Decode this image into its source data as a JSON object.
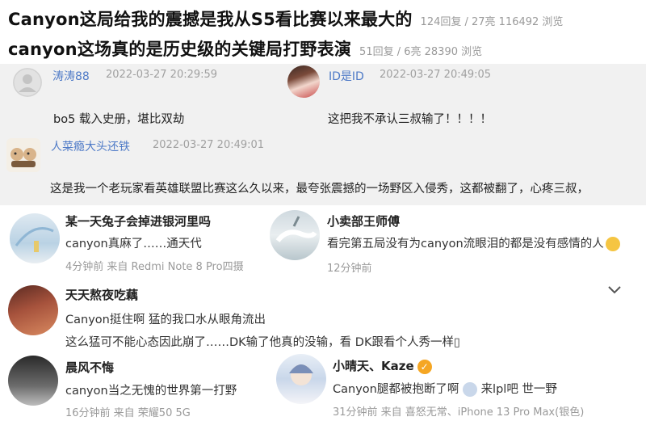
{
  "threads": [
    {
      "title": "Canyon这局给我的震撼是我从S5看比赛以来最大的",
      "meta": "124回复 / 27亮 116492 浏览"
    },
    {
      "title": "canyon这场真的是历史级的关键局打野表演",
      "meta": "51回复 / 6亮 28390 浏览"
    }
  ],
  "replies": [
    {
      "user": "涛涛88",
      "time": "2022-03-27 20:29:59",
      "body": "bo5 载入史册，堪比双劫"
    },
    {
      "user": "ID是ID",
      "time": "2022-03-27 20:49:05",
      "body": "这把我不承认三叔输了！！！！"
    },
    {
      "user": "人菜瘾大头还铁",
      "time": "2022-03-27 20:49:01",
      "body": "这是我一个老玩家看英雄联盟比赛这么久以来，最夸张震撼的一场野区入侵秀，这都被翻了，心疼三叔，"
    }
  ],
  "comments": [
    {
      "name": "某一天兔子会掉进银河里吗",
      "text": "canyon真麻了……通天代",
      "meta": "4分钟前  来自 Redmi Note 8 Pro四摄"
    },
    {
      "name": "小卖部王师傅",
      "text": "看完第五局没有为canyon流眼泪的都是没有感情的人",
      "meta": "12分钟前"
    },
    {
      "name": "天天熬夜吃藕",
      "text": "Canyon挺住啊 猛的我口水从眼角流出",
      "text2": "这么猛可不能心态因此崩了……DK输了他真的没输，看 DK跟看个人秀一样▯",
      "meta": ""
    },
    {
      "name": "晨风不悔",
      "text": "canyon当之无愧的世界第一打野",
      "meta": "16分钟前  来自 荣耀50 5G"
    },
    {
      "name": "小晴天、Kaze",
      "text": "Canyon腿都被抱断了啊",
      "text_b": "来lpl吧 世一野",
      "meta": "31分钟前  来自 喜怒无常、iPhone 13 Pro Max(银色)"
    }
  ],
  "colors": {
    "username": "#4e7ac7",
    "reply_bg": "#f1f1f1",
    "meta": "#9a9a9a"
  }
}
